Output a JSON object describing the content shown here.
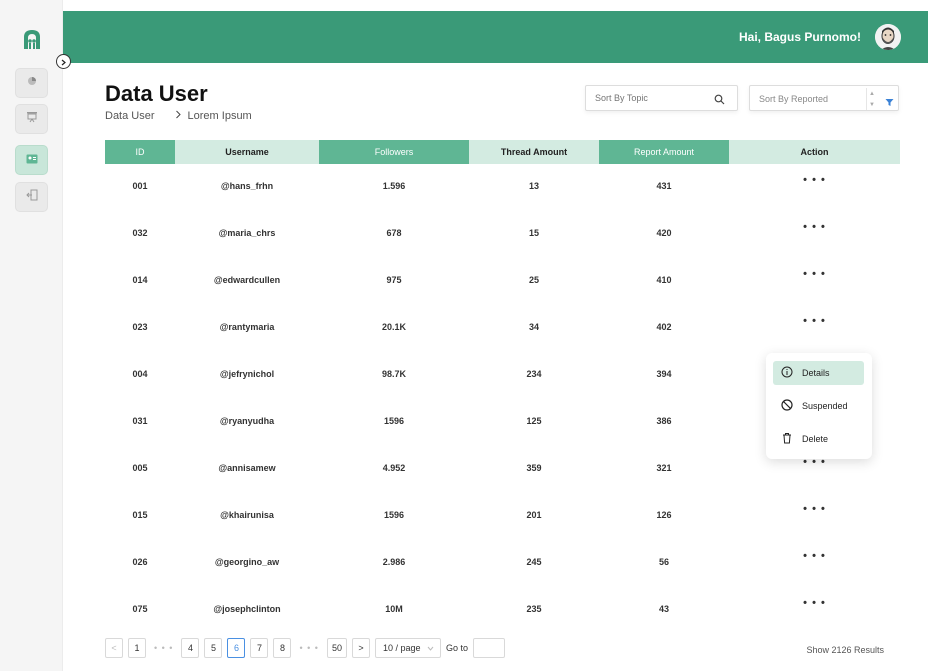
{
  "header": {
    "greeting": "Hai, Bagus Purnomo!"
  },
  "sidebar": {
    "items": [
      {
        "icon": "pie-chart-icon",
        "active": false
      },
      {
        "icon": "presentation-board-icon",
        "active": false
      },
      {
        "icon": "user-card-icon",
        "active": true
      },
      {
        "icon": "logout-icon",
        "active": false
      }
    ]
  },
  "page": {
    "title": "Data User",
    "breadcrumb": [
      "Data User",
      "Lorem Ipsum"
    ]
  },
  "search": {
    "placeholder": "Sort By Topic"
  },
  "sort": {
    "label": "Sort By Reported"
  },
  "table": {
    "columns": [
      "ID",
      "Username",
      "Followers",
      "Thread Amount",
      "Report Amount",
      "Action"
    ],
    "action_label": "• • •",
    "rows": [
      [
        "001",
        "@hans_frhn",
        "1.596",
        "13",
        "431"
      ],
      [
        "032",
        "@maria_chrs",
        "678",
        "15",
        "420"
      ],
      [
        "014",
        "@edwardcullen",
        "975",
        "25",
        "410"
      ],
      [
        "023",
        "@rantymaria",
        "20.1K",
        "34",
        "402"
      ],
      [
        "004",
        "@jefrynichol",
        "98.7K",
        "234",
        "394"
      ],
      [
        "031",
        "@ryanyudha",
        "1596",
        "125",
        "386"
      ],
      [
        "005",
        "@annisamew",
        "4.952",
        "359",
        "321"
      ],
      [
        "015",
        "@khairunisa",
        "1596",
        "201",
        "126"
      ],
      [
        "026",
        "@georgino_aw",
        "2.986",
        "245",
        "56"
      ],
      [
        "075",
        "@josephclinton",
        "10M",
        "235",
        "43"
      ]
    ]
  },
  "action_menu": {
    "items": [
      {
        "label": "Details",
        "icon": "info-icon",
        "active": true
      },
      {
        "label": "Suspended",
        "icon": "ban-icon",
        "active": false
      },
      {
        "label": "Delete",
        "icon": "trash-icon",
        "active": false
      }
    ]
  },
  "pagination": {
    "prev": "<",
    "next": ">",
    "pages": [
      "1",
      "4",
      "5",
      "6",
      "7",
      "8",
      "50"
    ],
    "ellipsis": "• • •",
    "current": "6",
    "page_size": "10 / page",
    "goto_label": "Go to"
  },
  "results_text": "Show 2126 Results",
  "colors": {
    "brand": "#3a9a78",
    "header_light": "#d3ebe1",
    "header_dark": "#5fb694"
  }
}
